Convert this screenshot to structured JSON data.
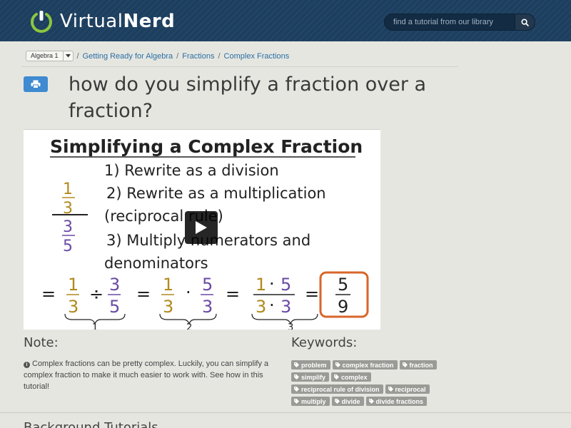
{
  "header": {
    "logo_light": "Virtual",
    "logo_bold": "Nerd",
    "search_placeholder": "find a tutorial from our library"
  },
  "breadcrumb": {
    "course": "Algebra 1",
    "items": [
      "Getting Ready for Algebra",
      "Fractions",
      "Complex Fractions"
    ],
    "separator": "/"
  },
  "page": {
    "title": "how do you simplify a fraction over a fraction?"
  },
  "video": {
    "heading": "Simplifying a Complex Fraction",
    "steps": [
      "1) Rewrite as a division",
      "2) Rewrite as a multiplication",
      "(reciprocal rule)",
      "3) Multiply numerators and",
      "denominators"
    ],
    "colors": {
      "gold": "#b08a1e",
      "purple": "#6a4aa5",
      "orange": "#d8662a"
    }
  },
  "note": {
    "heading": "Note:",
    "text": "Complex fractions can be pretty complex. Luckily, you can simplify a complex fraction to make it much easier to work with. See how in this tutorial!"
  },
  "keywords": {
    "heading": "Keywords:",
    "rows": [
      [
        "problem",
        "complex fraction",
        "fraction"
      ],
      [
        "simplify",
        "complex"
      ],
      [
        "reciprocal rule of division",
        "reciprocal"
      ],
      [
        "multiply",
        "divide",
        "divide fractions"
      ]
    ]
  },
  "background": {
    "heading": "Background Tutorials"
  }
}
